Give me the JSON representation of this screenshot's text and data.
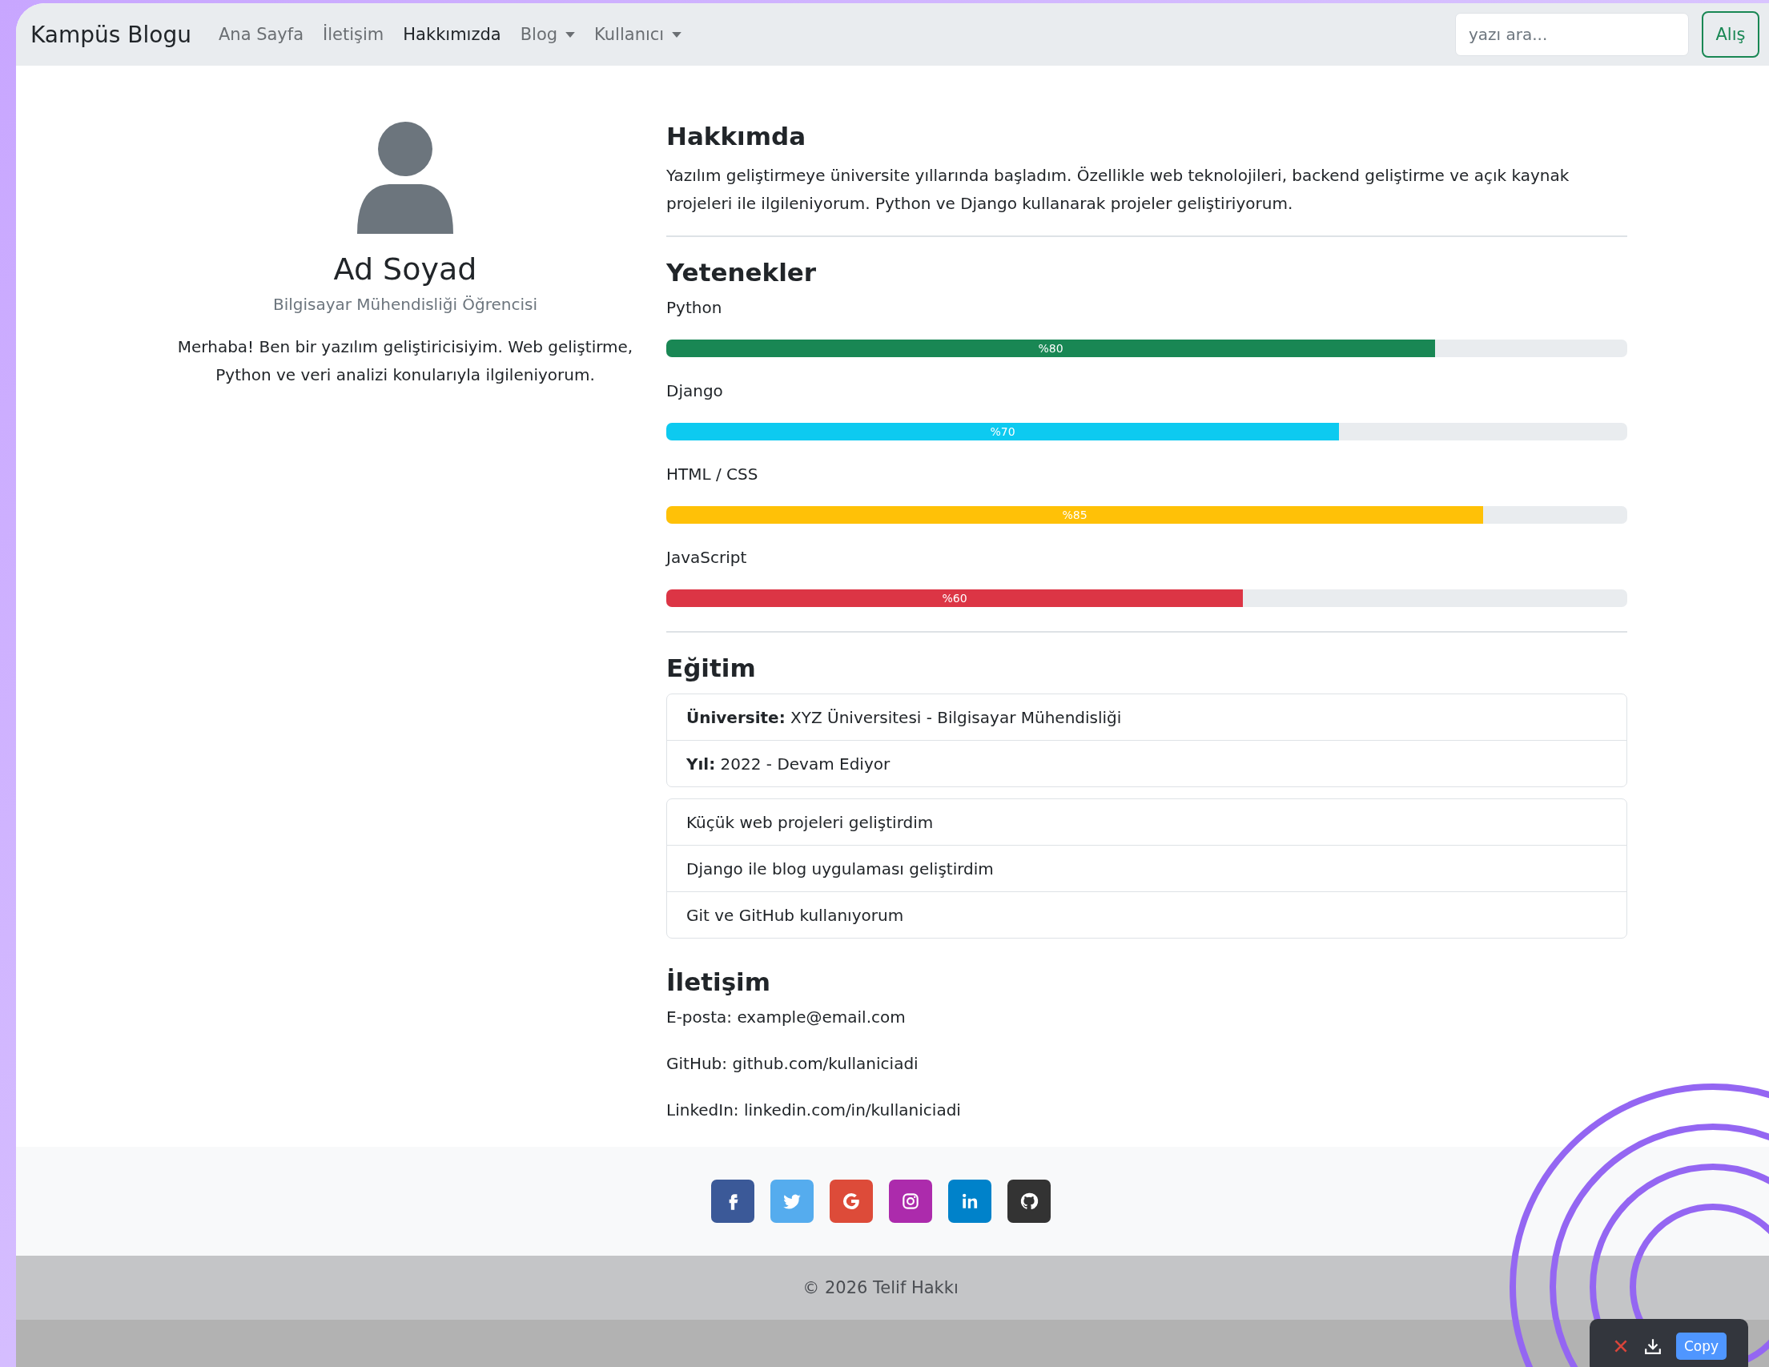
{
  "navbar": {
    "brand": "Kampüs Blogu",
    "items": [
      {
        "label": "Ana Sayfa",
        "selected": false,
        "kind": "link"
      },
      {
        "label": "İletişim",
        "selected": false,
        "kind": "link"
      },
      {
        "label": "Hakkımızda",
        "selected": true,
        "kind": "link"
      },
      {
        "label": "Blog",
        "selected": false,
        "kind": "dropdown"
      },
      {
        "label": "Kullanıcı",
        "selected": false,
        "kind": "dropdown"
      }
    ],
    "search": {
      "placeholder": "yazı ara...",
      "button": "Alış"
    }
  },
  "profile": {
    "name": "Ad Soyad",
    "title": "Bilgisayar Mühendisliği Öğrencisi",
    "bio": "Merhaba! Ben bir yazılım geliştiricisiyim. Web geliştirme, Python ve veri analizi konularıyla ilgileniyorum."
  },
  "about": {
    "heading": "Hakkımda",
    "text": "Yazılım geliştirmeye üniversite yıllarında başladım. Özellikle web teknolojileri, backend geliştirme ve açık kaynak projeleri ile ilgileniyorum. Python ve Django kullanarak projeler geliştiriyorum."
  },
  "skills": {
    "heading": "Yetenekler",
    "items": [
      {
        "name": "Python",
        "level": 0.8,
        "reading": "%80",
        "color": "#198754"
      },
      {
        "name": "Django",
        "level": 0.7,
        "reading": "%70",
        "color": "#0dcaf0"
      },
      {
        "name": "HTML / CSS",
        "level": 0.85,
        "reading": "%85",
        "color": "#ffc107"
      },
      {
        "name": "JavaScript",
        "level": 0.6,
        "reading": "%60",
        "color": "#dc3545"
      }
    ]
  },
  "education": {
    "heading": "Eğitim",
    "items": [
      "**Üniversite:** XYZ Üniversitesi - Bilgisayar Mühendisliği",
      "**Yıl:** 2022 - Devam Ediyor"
    ]
  },
  "experience": {
    "items": [
      "Küçük web projeleri geliştirdim",
      "Django ile blog uygulaması geliştirdim",
      "Git ve GitHub kullanıyorum"
    ]
  },
  "contact": {
    "heading": "İletişim",
    "items": [
      "E-posta: example@email.com",
      "GitHub: github.com/kullaniciadi",
      "LinkedIn: linkedin.com/in/kullaniciadi"
    ]
  },
  "footer": {
    "social": [
      {
        "kind": "facebook",
        "color": "#3b5998"
      },
      {
        "kind": "twitter",
        "color": "#55acee"
      },
      {
        "kind": "google",
        "color": "#dd4b39"
      },
      {
        "kind": "instagram",
        "color": "#ac2bac"
      },
      {
        "kind": "linkedin",
        "color": "#0082ca"
      },
      {
        "kind": "github",
        "color": "#333333"
      }
    ],
    "copyright": "© 2026 Telif Hakkı"
  },
  "capture_toolbar": {
    "button": "Copy"
  }
}
